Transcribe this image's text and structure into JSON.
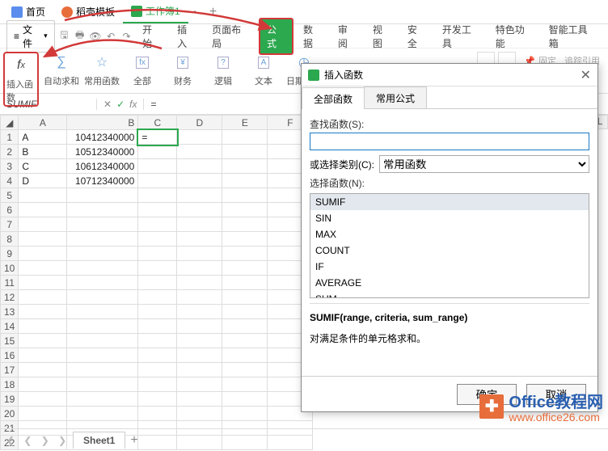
{
  "doc_tabs": {
    "home": "首页",
    "tpl": "稻壳模板",
    "wb": "工作簿1"
  },
  "file_label": "文件",
  "menu": {
    "start": "开始",
    "insert": "插入",
    "layout": "页面布局",
    "formula": "公式",
    "data": "数据",
    "review": "审阅",
    "view": "视图",
    "security": "安全",
    "dev": "开发工具",
    "special": "特色功能",
    "toolbox": "智能工具箱"
  },
  "ribbon": {
    "fx": "插入函数",
    "autosum": "自动求和",
    "common": "常用函数",
    "all": "全部",
    "finance": "财务",
    "logic": "逻辑",
    "text": "文本",
    "datetime": "日期和时",
    "pin": "固定",
    "track": "追踪引用"
  },
  "name_box": "SUMIF",
  "formula_value": "=",
  "columns": [
    "A",
    "B",
    "C",
    "D",
    "E",
    "F"
  ],
  "visible_far_cols": [
    "L"
  ],
  "rows": [
    {
      "n": 1,
      "A": "A",
      "B": "10412340000",
      "C": "="
    },
    {
      "n": 2,
      "A": "B",
      "B": "10512340000",
      "C": ""
    },
    {
      "n": 3,
      "A": "C",
      "B": "10612340000",
      "C": ""
    },
    {
      "n": 4,
      "A": "D",
      "B": "10712340000",
      "C": ""
    }
  ],
  "empty_rows": [
    5,
    6,
    7,
    8,
    9,
    10,
    11,
    12,
    13,
    14,
    15,
    16,
    17,
    18,
    19,
    20,
    21,
    22
  ],
  "sheet_tab": "Sheet1",
  "dialog": {
    "title": "插入函数",
    "tab_all": "全部函数",
    "tab_common": "常用公式",
    "search_label": "查找函数(S):",
    "category_label": "或选择类别(C):",
    "category_value": "常用函数",
    "select_label": "选择函数(N):",
    "functions": [
      "SUMIF",
      "SIN",
      "MAX",
      "COUNT",
      "IF",
      "AVERAGE",
      "SUM"
    ],
    "signature": "SUMIF(range, criteria, sum_range)",
    "description": "对满足条件的单元格求和。",
    "ok": "确定",
    "cancel": "取消"
  },
  "watermark": {
    "brand": "Office教程网",
    "url": "www.office26.com"
  }
}
